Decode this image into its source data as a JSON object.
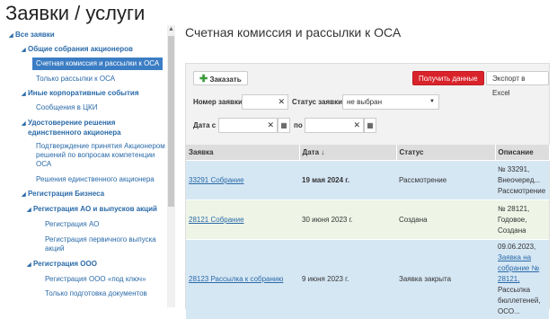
{
  "page": {
    "title": "Заявки / услуги"
  },
  "sidebar": {
    "items": [
      "Все заявки",
      "Общие собрания акционеров",
      "Счетная комиссия и рассылки к ОСА",
      "Только рассылки к ОСА",
      "Иные корпоративные события",
      "Сообщения в ЦКИ",
      "Удостоверение решения",
      "единственного акционера",
      "Подтверждение принятия Акционером",
      "решений по вопросам компетенции",
      "ОСА",
      "Решения единственного акционера",
      "Регистрация Бизнеса",
      "Регистрация АО и выпусков акций",
      "Регистрация АО",
      "Регистрация первичного выпуска",
      "акций",
      "Регистрация ООО",
      "Регистрация ООО «под ключ»",
      "Только подготовка документов"
    ]
  },
  "main": {
    "title": "Счетная комиссия и рассылки к ОСА",
    "toolbar": {
      "order": "Заказать",
      "get_data": "Получить данные",
      "export": "Экспорт в Excel"
    },
    "filters": {
      "number_label": "Номер заявки",
      "status_label": "Статус заявки",
      "status_value": "не выбран",
      "date_from_label": "Дата с",
      "date_to_label": "по"
    },
    "table": {
      "headers": [
        "Заявка",
        "Дата",
        "Статус",
        "Описание"
      ],
      "sort_indicator": "↓",
      "rows": [
        {
          "link": "33291 Собрание",
          "date": "19 мая 2024 г.",
          "status": "Рассмотрение",
          "desc1": "№ 33291,",
          "desc2": "Внеочеред...",
          "desc3": "Рассмотрение"
        },
        {
          "link": "28121 Собрание",
          "date": "30 июня 2023 г.",
          "status": "Создана",
          "desc1": "№ 28121,",
          "desc2": "Годовое,",
          "desc3": "Создана"
        },
        {
          "link": "28123 Рассылка к собранию",
          "date": "9 июня 2023 г.",
          "status": "Заявка закрыта",
          "desc1": "09.06.2023,",
          "desc_link1": "Заявка на",
          "desc_link2": "собрание №",
          "desc_link3": "28121,",
          "desc4": "Рассылка",
          "desc5": "бюллетеней,",
          "desc6": "ОСО..."
        }
      ]
    }
  }
}
